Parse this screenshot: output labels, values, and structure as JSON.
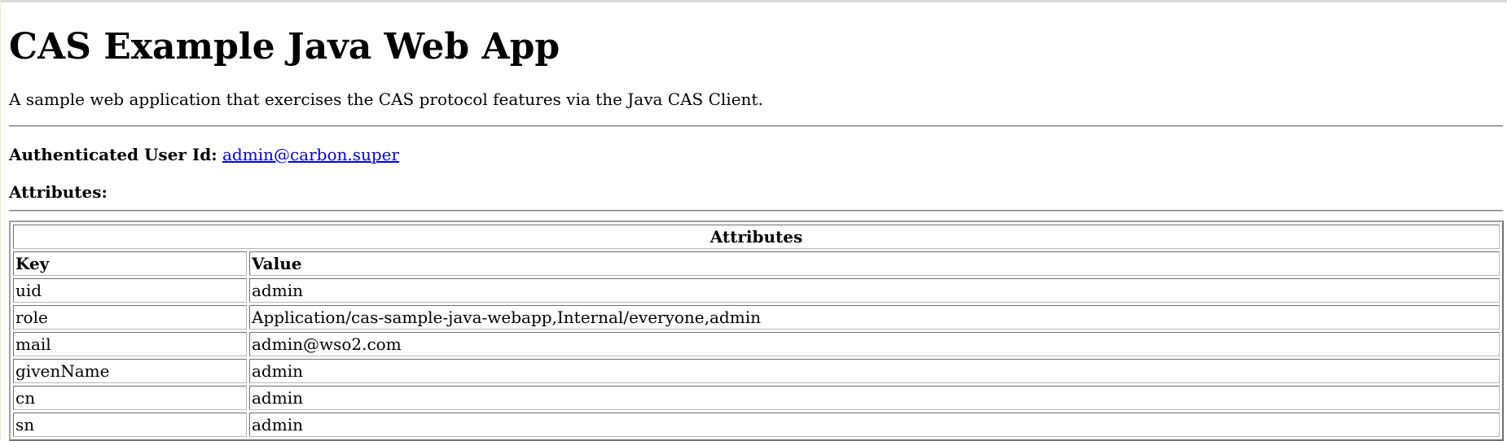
{
  "page": {
    "title": "CAS Example Java Web App",
    "description": "A sample web application that exercises the CAS protocol features via the Java CAS Client."
  },
  "user": {
    "label": "Authenticated User Id:",
    "id": "admin@carbon.super"
  },
  "attributes_label": "Attributes:",
  "table": {
    "caption": "Attributes",
    "headers": {
      "key": "Key",
      "value": "Value"
    },
    "rows": [
      {
        "key": "uid",
        "value": "admin"
      },
      {
        "key": "role",
        "value": "Application/cas-sample-java-webapp,Internal/everyone,admin"
      },
      {
        "key": "mail",
        "value": "admin@wso2.com"
      },
      {
        "key": "givenName",
        "value": "admin"
      },
      {
        "key": "cn",
        "value": "admin"
      },
      {
        "key": "sn",
        "value": "admin"
      }
    ]
  },
  "colors": {
    "link": "#0000ee",
    "text": "#000000",
    "background": "#ffffff"
  }
}
